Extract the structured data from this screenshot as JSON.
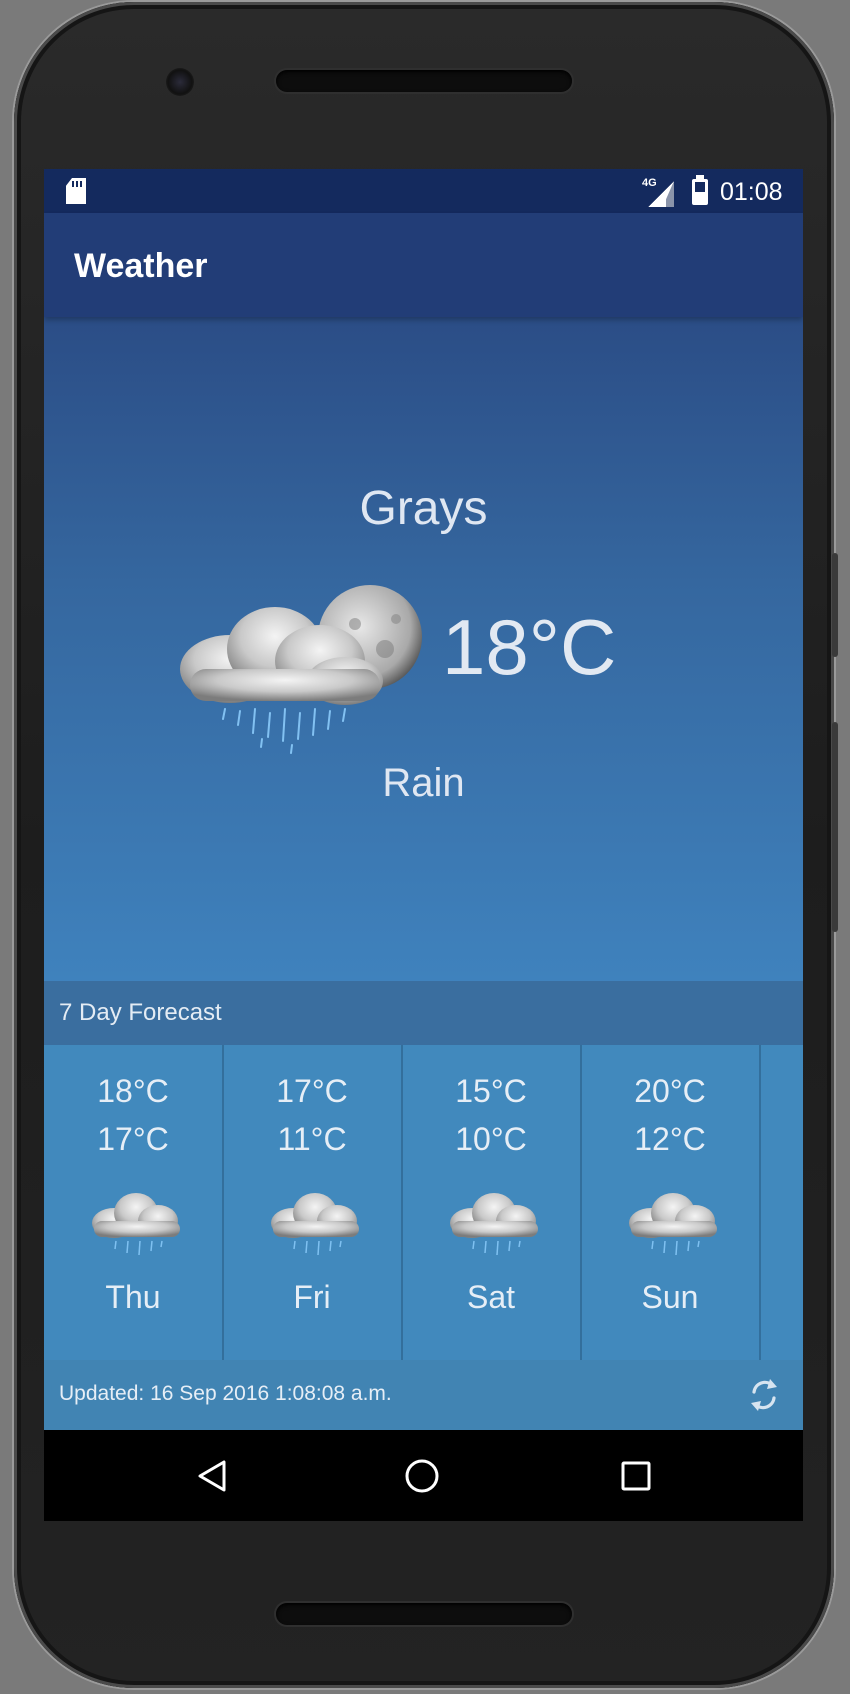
{
  "status_bar": {
    "network": "4G",
    "time": "01:08",
    "icons": [
      "sd-card-icon",
      "signal-icon",
      "battery-charging-icon"
    ]
  },
  "app_bar": {
    "title": "Weather"
  },
  "current": {
    "city": "Grays",
    "temperature": "18°C",
    "description": "Rain",
    "icon": "night-rain-cloud-icon"
  },
  "forecast": {
    "title": "7 Day Forecast",
    "days": [
      {
        "high": "18°C",
        "low": "17°C",
        "day": "Thu",
        "icon": "rain-cloud-icon"
      },
      {
        "high": "17°C",
        "low": "11°C",
        "day": "Fri",
        "icon": "rain-cloud-icon"
      },
      {
        "high": "15°C",
        "low": "10°C",
        "day": "Sat",
        "icon": "rain-cloud-icon"
      },
      {
        "high": "20°C",
        "low": "12°C",
        "day": "Sun",
        "icon": "rain-cloud-icon"
      }
    ]
  },
  "footer": {
    "updated": "Updated: 16 Sep 2016 1:08:08 a.m.",
    "refresh_icon": "refresh-icon"
  },
  "nav": {
    "buttons": [
      "back-icon",
      "home-icon",
      "recents-icon"
    ]
  },
  "colors": {
    "status_bar": "#142a5e",
    "app_bar": "#223d77",
    "gradient_top": "#2b4d86",
    "gradient_bottom": "#3f82bd",
    "forecast_strip": "#4189bd"
  }
}
